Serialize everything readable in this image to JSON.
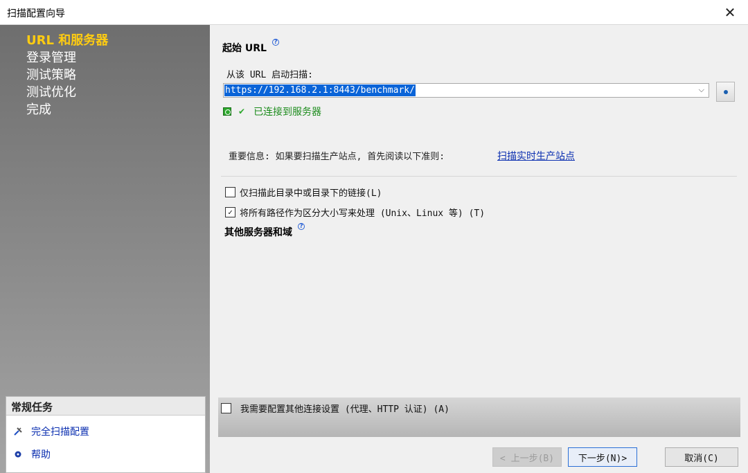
{
  "window": {
    "title": "扫描配置向导",
    "close_label": "✕"
  },
  "sidebar": {
    "steps": [
      {
        "label": "URL 和服务器",
        "active": true
      },
      {
        "label": "登录管理"
      },
      {
        "label": "测试策略"
      },
      {
        "label": "测试优化"
      },
      {
        "label": "完成"
      }
    ],
    "tasks": {
      "header": "常规任务",
      "items": [
        {
          "label": "完全扫描配置",
          "icon": "wrench-icon"
        },
        {
          "label": "帮助",
          "icon": "help-icon"
        }
      ]
    }
  },
  "main": {
    "start_url": {
      "title": "起始 URL",
      "help": "?",
      "label": "从该 URL 启动扫描:",
      "value": "https://192.168.2.1:8443/benchmark/",
      "dropdown_arrow": "⌵"
    },
    "connection": {
      "check": "✔",
      "status": "已连接到服务器"
    },
    "important": {
      "text": "重要信息: 如果要扫描生产站点, 首先阅读以下准则:",
      "link": "扫描实时生产站点"
    },
    "options": [
      {
        "label": "仅扫描此目录中或目录下的链接(L)",
        "checked": false
      },
      {
        "label": "将所有路径作为区分大小写来处理 (Unix、Linux 等) (T)",
        "checked": true
      }
    ],
    "other_servers": {
      "title": "其他服务器和域",
      "help": "?"
    },
    "extra_connection": {
      "label": "我需要配置其他连接设置 (代理、HTTP 认证) (A)",
      "checked": false
    }
  },
  "footer": {
    "back_label": "< 上一步(B)",
    "next_label": "下一步(N)>",
    "cancel_label": "取消(C)"
  },
  "colors": {
    "active_step": "#ffcc11",
    "link": "#0b2fb0",
    "connected": "#1d8c1d",
    "selection": "#0a64d8"
  }
}
